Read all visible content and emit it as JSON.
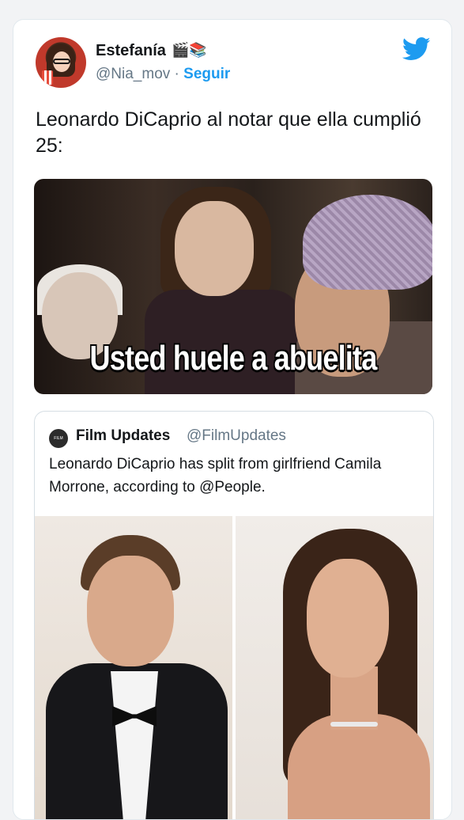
{
  "tweet": {
    "author_name": "Estefanía",
    "author_emojis": "🎬📚",
    "handle": "@Nia_mov",
    "separator": "·",
    "follow_label": "Seguir",
    "text": "Leonardo DiCaprio al notar que ella cumplió 25:",
    "meme_caption": "Usted huele a abuelita"
  },
  "quoted": {
    "author_name": "Film Updates",
    "handle": "@FilmUpdates",
    "avatar_text": "FILM UPDATES",
    "text": "Leonardo DiCaprio has split from girlfriend Camila Morrone, according to @People."
  },
  "icons": {
    "brand": "twitter-bird-icon"
  },
  "colors": {
    "accent": "#1d9bf0",
    "text": "#14171a",
    "muted": "#657786"
  }
}
